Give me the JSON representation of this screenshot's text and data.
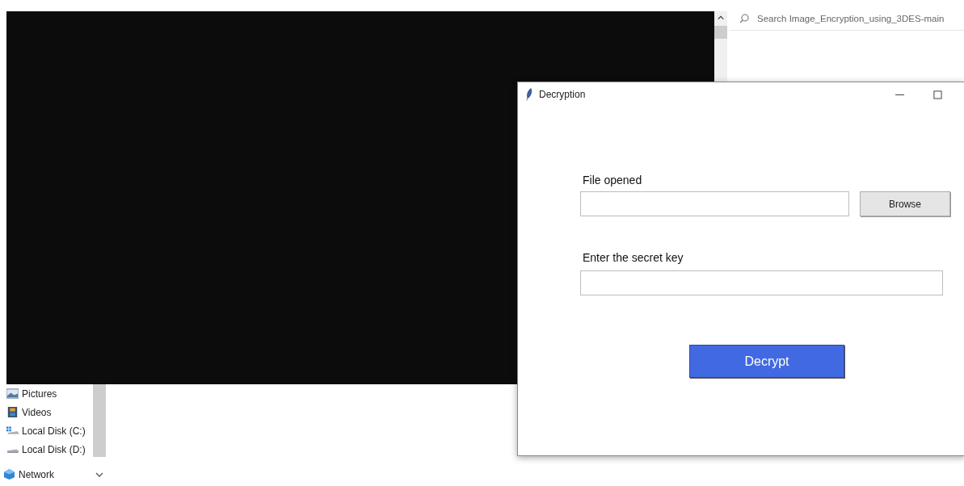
{
  "explorer": {
    "search": {
      "placeholder": "Search Image_Encryption_using_3DES-main"
    },
    "nav_items": [
      {
        "label": "Pictures",
        "kind": "pictures"
      },
      {
        "label": "Videos",
        "kind": "videos"
      },
      {
        "label": "Local Disk (C:)",
        "kind": "system-disk"
      },
      {
        "label": "Local Disk (D:)",
        "kind": "disk"
      },
      {
        "label": "Network",
        "kind": "network"
      }
    ]
  },
  "dialog": {
    "title": "Decryption",
    "file_field": {
      "label": "File opened"
    },
    "browse_button": "Browse",
    "key_field": {
      "label": "Enter the secret key"
    },
    "decrypt_button": "Decrypt"
  }
}
